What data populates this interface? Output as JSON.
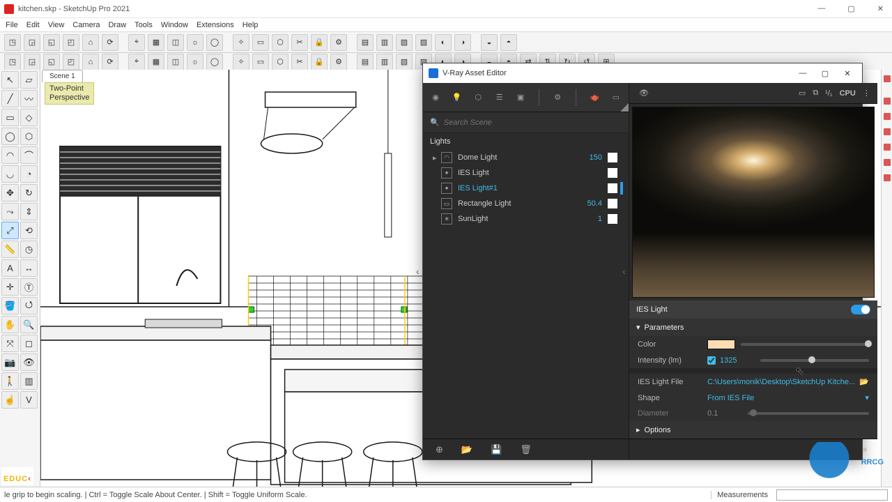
{
  "window": {
    "title": "kitchen.skp - SketchUp Pro 2021"
  },
  "menu": [
    "File",
    "Edit",
    "View",
    "Camera",
    "Draw",
    "Tools",
    "Window",
    "Extensions",
    "Help"
  ],
  "scene_tab": "Scene 1",
  "viewport": {
    "camera_label": "Two-Point\nPerspective"
  },
  "left_tools": [
    "select-tool",
    "eraser-tool",
    "line-tool",
    "freehand-tool",
    "rectangle-tool",
    "rotated-rectangle-tool",
    "circle-tool",
    "polygon-tool",
    "arc-tool",
    "2pt-arc-tool",
    "3pt-arc-tool",
    "pie-tool",
    "move-tool",
    "rotate-tool",
    "follow-me-tool",
    "push-pull-tool",
    "scale-tool",
    "offset-tool",
    "tape-measure-tool",
    "protractor-tool",
    "text-tool",
    "dimension-tool",
    "axes-tool",
    "3d-text-tool",
    "paint-bucket-tool",
    "orbit-tool",
    "pan-tool",
    "zoom-tool",
    "zoom-extents-tool",
    "zoom-window-tool",
    "position-camera-tool",
    "look-around-tool",
    "walk-tool",
    "section-plane-tool",
    "interact-tool",
    "vray-asset-btn"
  ],
  "main_toolbar_count": 25,
  "second_toolbar_count": 30,
  "vray": {
    "title": "V-Ray Asset Editor",
    "search_placeholder": "Search Scene",
    "section": "Lights",
    "lights": [
      {
        "name": "Dome Light",
        "value": "150",
        "swatch": "#ffffff",
        "selected": false,
        "icon": "dome",
        "mark": "",
        "expandable": true
      },
      {
        "name": "IES Light",
        "value": "",
        "swatch": "#ffffff",
        "selected": false,
        "icon": "ies",
        "mark": "",
        "expandable": false
      },
      {
        "name": "IES Light#1",
        "value": "",
        "swatch": "#ffffff",
        "selected": true,
        "icon": "ies",
        "mark": "#2d9be8",
        "expandable": false
      },
      {
        "name": "Rectangle Light",
        "value": "50.4",
        "swatch": "#ffffff",
        "selected": false,
        "icon": "rect",
        "mark": "",
        "expandable": false
      },
      {
        "name": "SunLight",
        "value": "1",
        "swatch": "#ffffff",
        "selected": false,
        "icon": "sun",
        "mark": "",
        "expandable": false
      }
    ],
    "render_mode": "CPU",
    "render_quality": "¹/₁",
    "properties": {
      "header": "IES Light",
      "group": "Parameters",
      "color_label": "Color",
      "color_value": "#ffddb3",
      "intensity_label": "Intensity (lm)",
      "intensity_value": "1325",
      "intensity_checked": true,
      "ies_file_label": "IES Light File",
      "ies_file_path": "C:\\Users\\monik\\Desktop\\SketchUp Kitche...",
      "shape_label": "Shape",
      "shape_value": "From IES File",
      "diameter_label": "Diameter",
      "diameter_value": "0.1",
      "options_group": "Options"
    }
  },
  "statusbar": {
    "hint": "le grip to begin scaling. | Ctrl = Toggle Scale About Center. | Shift = Toggle Uniform Scale.",
    "measurements_label": "Measurements"
  },
  "watermark_left": "EDUCK",
  "watermark_right": "RRCG"
}
